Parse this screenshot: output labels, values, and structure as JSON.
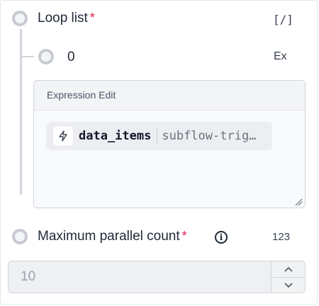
{
  "loop_list": {
    "label": "Loop list",
    "required_mark": "*",
    "type_tag": "[/]"
  },
  "item": {
    "value": "0",
    "type_tag": "Ex"
  },
  "expression_editor": {
    "header": "Expression Edit",
    "chip": {
      "icon": "lightning-icon",
      "name": "data_items",
      "source": "subflow-trig…"
    }
  },
  "max_parallel": {
    "label": "Maximum parallel count",
    "required_mark": "*",
    "info_icon": "info-icon",
    "info_glyph": "i",
    "type_tag": "123",
    "value": "10"
  },
  "colors": {
    "required": "#e11d48",
    "border": "#d1d5db",
    "text": "#1f2937"
  }
}
